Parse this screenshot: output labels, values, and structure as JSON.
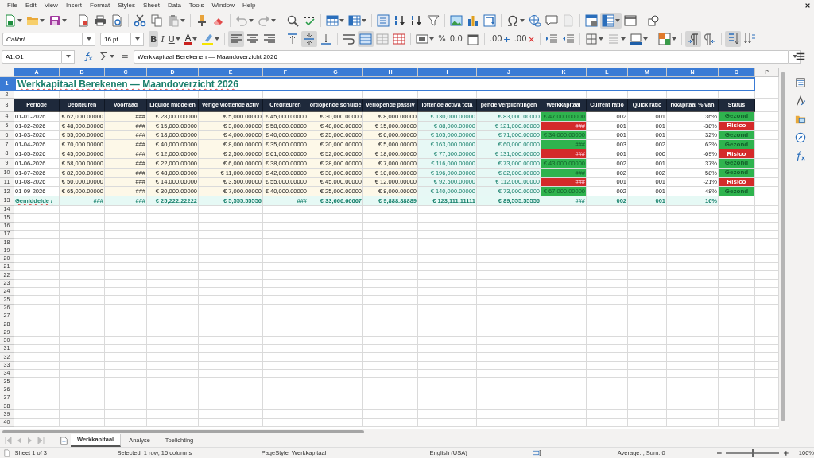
{
  "menu": [
    "File",
    "Edit",
    "View",
    "Insert",
    "Format",
    "Styles",
    "Sheet",
    "Data",
    "Tools",
    "Window",
    "Help"
  ],
  "standard_toolbar": [
    [
      {
        "kind": "new",
        "pressed": false
      },
      {
        "kind": "open",
        "pressed": false
      },
      {
        "kind": "save",
        "pressed": false
      }
    ],
    [
      {
        "kind": "pdf",
        "pressed": false
      },
      {
        "kind": "print",
        "pressed": false
      },
      {
        "kind": "preview",
        "pressed": false
      }
    ],
    [
      {
        "kind": "cut",
        "pressed": false
      },
      {
        "kind": "copy",
        "pressed": false
      },
      {
        "kind": "paste",
        "pressed": false
      }
    ],
    [
      {
        "kind": "clone",
        "pressed": false
      },
      {
        "kind": "clear",
        "pressed": false
      }
    ],
    [
      {
        "kind": "undo",
        "pressed": false
      },
      {
        "kind": "redo",
        "pressed": false
      }
    ],
    [
      {
        "kind": "find",
        "pressed": false
      },
      {
        "kind": "spell",
        "pressed": false
      }
    ],
    [
      {
        "kind": "row",
        "pressed": false
      },
      {
        "kind": "column",
        "pressed": false
      }
    ],
    [
      {
        "kind": "sort",
        "pressed": false
      },
      {
        "kind": "sortasc",
        "pressed": false
      },
      {
        "kind": "sortdesc",
        "pressed": false
      },
      {
        "kind": "filter",
        "pressed": false
      }
    ],
    [
      {
        "kind": "image",
        "pressed": false
      },
      {
        "kind": "chart",
        "pressed": false
      },
      {
        "kind": "pivot",
        "pressed": false
      }
    ],
    [
      {
        "kind": "special",
        "pressed": false
      },
      {
        "kind": "link",
        "pressed": false
      },
      {
        "kind": "comment",
        "pressed": false
      },
      {
        "kind": "header",
        "pressed": false
      }
    ],
    [
      {
        "kind": "printarea",
        "pressed": false
      },
      {
        "kind": "freeze",
        "pressed": true
      },
      {
        "kind": "split",
        "pressed": false
      }
    ],
    [
      {
        "kind": "shapes",
        "pressed": false
      }
    ]
  ],
  "font_name": "Calibri",
  "font_size": "16 pt",
  "formatting_toolbar": [
    [
      {
        "kind": "bold",
        "label": "B",
        "pressed": true
      },
      {
        "kind": "italic",
        "label": "I",
        "pressed": false
      },
      {
        "kind": "underline",
        "label": "U",
        "pressed": false
      },
      {
        "kind": "fontcolor",
        "label": "A",
        "pressed": false
      },
      {
        "kind": "highlight",
        "pressed": false
      }
    ],
    [
      {
        "kind": "alignleft",
        "pressed": true
      },
      {
        "kind": "aligncenter",
        "pressed": false
      },
      {
        "kind": "alignright",
        "pressed": false
      }
    ],
    [
      {
        "kind": "top",
        "pressed": false
      },
      {
        "kind": "vcenter",
        "pressed": true
      },
      {
        "kind": "bottom",
        "pressed": false
      }
    ],
    [
      {
        "kind": "wrap",
        "pressed": false
      },
      {
        "kind": "merge",
        "pressed": true
      },
      {
        "kind": "unmerge",
        "pressed": false
      },
      {
        "kind": "mergecells",
        "pressed": false
      }
    ],
    [
      {
        "kind": "numfmt",
        "pressed": false
      },
      {
        "kind": "percent",
        "label": "%",
        "pressed": false
      },
      {
        "kind": "decfmt",
        "label": "0.0",
        "pressed": false
      },
      {
        "kind": "date",
        "pressed": false
      }
    ],
    [
      {
        "kind": "adddec",
        "label": ".00",
        "pressed": false
      },
      {
        "kind": "deldec",
        "label": ".00",
        "pressed": false
      }
    ],
    [
      {
        "kind": "indent",
        "pressed": false
      },
      {
        "kind": "outdent",
        "pressed": false
      }
    ],
    [
      {
        "kind": "borders",
        "pressed": false
      },
      {
        "kind": "borderstyle",
        "pressed": false
      },
      {
        "kind": "bordercolor",
        "pressed": false
      }
    ],
    [
      {
        "kind": "conditional",
        "pressed": false
      }
    ],
    [
      {
        "kind": "ltr",
        "pressed": true
      },
      {
        "kind": "rtl",
        "pressed": false
      }
    ],
    [
      {
        "kind": "vstack",
        "pressed": true
      },
      {
        "kind": "vtext",
        "pressed": false
      }
    ]
  ],
  "name_box": "A1:O1",
  "formula": "Werkkapitaal Berekenen — Maandoverzicht 2026",
  "sheet": {
    "columns": [
      {
        "letter": "A",
        "kind": "text",
        "selected": true
      },
      {
        "letter": "B",
        "kind": "input",
        "selected": true
      },
      {
        "letter": "C",
        "kind": "input",
        "selected": true
      },
      {
        "letter": "D",
        "kind": "input",
        "selected": true
      },
      {
        "letter": "E",
        "kind": "input",
        "selected": true
      },
      {
        "letter": "F",
        "kind": "input",
        "selected": true
      },
      {
        "letter": "G",
        "kind": "input",
        "selected": true
      },
      {
        "letter": "H",
        "kind": "input",
        "selected": true
      },
      {
        "letter": "I",
        "kind": "calc",
        "selected": true
      },
      {
        "letter": "J",
        "kind": "calc",
        "selected": true
      },
      {
        "letter": "K",
        "kind": "result",
        "selected": true
      },
      {
        "letter": "L",
        "kind": "plain",
        "selected": true
      },
      {
        "letter": "M",
        "kind": "plain",
        "selected": true
      },
      {
        "letter": "N",
        "kind": "plain",
        "selected": true
      },
      {
        "letter": "O",
        "kind": "status",
        "selected": true
      },
      {
        "letter": "P",
        "kind": "empty",
        "selected": false
      }
    ],
    "rows": [
      {
        "number": "1",
        "kind": "title",
        "selected": true,
        "cells": [
          "Werkkapitaal Berekenen — Maandoverzicht 2026"
        ]
      },
      {
        "number": "2",
        "kind": "blank",
        "selected": false
      },
      {
        "number": "3",
        "kind": "header",
        "selected": false,
        "cells": [
          "Periode",
          "Debiteuren",
          "Voorraad",
          "Liquide middelen",
          "verige vlottende activ",
          "Crediteuren",
          "ortlopende schulde",
          "verlopende passiv",
          "lottende activa tota",
          "pende verplichtingen",
          "Werkkapitaal",
          "Current ratio",
          "Quick ratio",
          "rkkapitaal % van",
          "Status"
        ]
      },
      {
        "number": "4",
        "kind": "data",
        "selected": false,
        "healthy": true,
        "cells": [
          "01-01-2026",
          "€ 62,000.00000",
          "###",
          "€ 28,000.00000",
          "€ 5,000.00000",
          "€ 45,000.00000",
          "€ 30,000.00000",
          "€ 8,000.00000",
          "€ 130,000.00000",
          "€ 83,000.00000",
          "€ 47,000.00000",
          "002",
          "001",
          "36%",
          "Gezond"
        ]
      },
      {
        "number": "5",
        "kind": "data",
        "selected": false,
        "healthy": false,
        "cells": [
          "01-02-2026",
          "€ 48,000.00000",
          "###",
          "€ 15,000.00000",
          "€ 3,000.00000",
          "€ 58,000.00000",
          "€ 48,000.00000",
          "€ 15,000.00000",
          "€ 88,000.00000",
          "€ 121,000.00000",
          "###",
          "001",
          "001",
          "-38%",
          "Risico"
        ]
      },
      {
        "number": "6",
        "kind": "data",
        "selected": false,
        "healthy": true,
        "cells": [
          "01-03-2026",
          "€ 55,000.00000",
          "###",
          "€ 18,000.00000",
          "€ 4,000.00000",
          "€ 40,000.00000",
          "€ 25,000.00000",
          "€ 6,000.00000",
          "€ 105,000.00000",
          "€ 71,000.00000",
          "€ 34,000.00000",
          "001",
          "001",
          "32%",
          "Gezond"
        ]
      },
      {
        "number": "7",
        "kind": "data",
        "selected": false,
        "healthy": true,
        "cells": [
          "01-04-2026",
          "€ 70,000.00000",
          "###",
          "€ 40,000.00000",
          "€ 8,000.00000",
          "€ 35,000.00000",
          "€ 20,000.00000",
          "€ 5,000.00000",
          "€ 163,000.00000",
          "€ 60,000.00000",
          "###",
          "003",
          "002",
          "63%",
          "Gezond"
        ]
      },
      {
        "number": "8",
        "kind": "data",
        "selected": false,
        "healthy": false,
        "cells": [
          "01-05-2026",
          "€ 45,000.00000",
          "###",
          "€ 12,000.00000",
          "€ 2,500.00000",
          "€ 61,000.00000",
          "€ 52,000.00000",
          "€ 18,000.00000",
          "€ 77,500.00000",
          "€ 131,000.00000",
          "###",
          "001",
          "000",
          "-69%",
          "Risico"
        ]
      },
      {
        "number": "9",
        "kind": "data",
        "selected": false,
        "healthy": true,
        "cells": [
          "01-06-2026",
          "€ 58,000.00000",
          "###",
          "€ 22,000.00000",
          "€ 6,000.00000",
          "€ 38,000.00000",
          "€ 28,000.00000",
          "€ 7,000.00000",
          "€ 116,000.00000",
          "€ 73,000.00000",
          "€ 43,000.00000",
          "002",
          "001",
          "37%",
          "Gezond"
        ]
      },
      {
        "number": "10",
        "kind": "data",
        "selected": false,
        "healthy": true,
        "cells": [
          "01-07-2026",
          "€ 82,000.00000",
          "###",
          "€ 48,000.00000",
          "€ 11,000.00000",
          "€ 42,000.00000",
          "€ 30,000.00000",
          "€ 10,000.00000",
          "€ 196,000.00000",
          "€ 82,000.00000",
          "###",
          "002",
          "002",
          "58%",
          "Gezond"
        ]
      },
      {
        "number": "11",
        "kind": "data",
        "selected": false,
        "healthy": false,
        "cells": [
          "01-08-2026",
          "€ 50,000.00000",
          "###",
          "€ 14,000.00000",
          "€ 3,500.00000",
          "€ 55,000.00000",
          "€ 45,000.00000",
          "€ 12,000.00000",
          "€ 92,500.00000",
          "€ 112,000.00000",
          "###",
          "001",
          "001",
          "-21%",
          "Risico"
        ]
      },
      {
        "number": "12",
        "kind": "data",
        "selected": false,
        "healthy": true,
        "cells": [
          "01-09-2026",
          "€ 65,000.00000",
          "###",
          "€ 30,000.00000",
          "€ 7,000.00000",
          "€ 40,000.00000",
          "€ 25,000.00000",
          "€ 8,000.00000",
          "€ 140,000.00000",
          "€ 73,000.00000",
          "€ 67,000.00000",
          "002",
          "001",
          "48%",
          "Gezond"
        ]
      },
      {
        "number": "13",
        "kind": "average",
        "selected": false,
        "cells": [
          "Gemiddelde /",
          "###",
          "###",
          "€ 25,222.22222",
          "€ 5,555.55556",
          "###",
          "€ 33,666.66667",
          "€ 9,888.88889",
          "€ 123,111.11111",
          "€ 89,555.55556",
          "###",
          "002",
          "001",
          "16%"
        ]
      },
      {
        "number": "14",
        "kind": "empty",
        "selected": false
      },
      {
        "number": "15",
        "kind": "empty",
        "selected": false
      },
      {
        "number": "16",
        "kind": "empty",
        "selected": false
      },
      {
        "number": "17",
        "kind": "empty",
        "selected": false
      },
      {
        "number": "18",
        "kind": "empty",
        "selected": false
      },
      {
        "number": "19",
        "kind": "empty",
        "selected": false
      },
      {
        "number": "20",
        "kind": "empty",
        "selected": false
      },
      {
        "number": "21",
        "kind": "empty",
        "selected": false
      },
      {
        "number": "22",
        "kind": "empty",
        "selected": false
      },
      {
        "number": "23",
        "kind": "empty",
        "selected": false
      },
      {
        "number": "24",
        "kind": "empty",
        "selected": false
      },
      {
        "number": "25",
        "kind": "empty",
        "selected": false
      },
      {
        "number": "26",
        "kind": "empty",
        "selected": false
      },
      {
        "number": "27",
        "kind": "empty",
        "selected": false
      },
      {
        "number": "28",
        "kind": "empty",
        "selected": false
      },
      {
        "number": "29",
        "kind": "empty",
        "selected": false
      },
      {
        "number": "30",
        "kind": "empty",
        "selected": false
      },
      {
        "number": "31",
        "kind": "empty",
        "selected": false
      },
      {
        "number": "32",
        "kind": "empty",
        "selected": false
      },
      {
        "number": "33",
        "kind": "empty",
        "selected": false
      },
      {
        "number": "34",
        "kind": "empty",
        "selected": false
      },
      {
        "number": "35",
        "kind": "empty",
        "selected": false
      },
      {
        "number": "36",
        "kind": "empty",
        "selected": false
      },
      {
        "number": "37",
        "kind": "empty",
        "selected": false
      },
      {
        "number": "38",
        "kind": "empty",
        "selected": false
      },
      {
        "number": "39",
        "kind": "empty",
        "selected": false
      },
      {
        "number": "40",
        "kind": "empty",
        "selected": false
      }
    ]
  },
  "sheet_tabs": [
    {
      "label": "Werkkapitaal",
      "selected": true
    },
    {
      "label": "Analyse",
      "selected": false
    },
    {
      "label": "Toelichting",
      "selected": false
    }
  ],
  "status_bar": {
    "sheet": "Sheet 1 of 3",
    "selection": "Selected: 1 row, 15 columns",
    "page_style": "PageStyle_Werkkapitaal",
    "language": "English (USA)",
    "summary": "Average: ; Sum: 0",
    "zoom": {
      "level": 0.5,
      "reading": "100%"
    }
  }
}
